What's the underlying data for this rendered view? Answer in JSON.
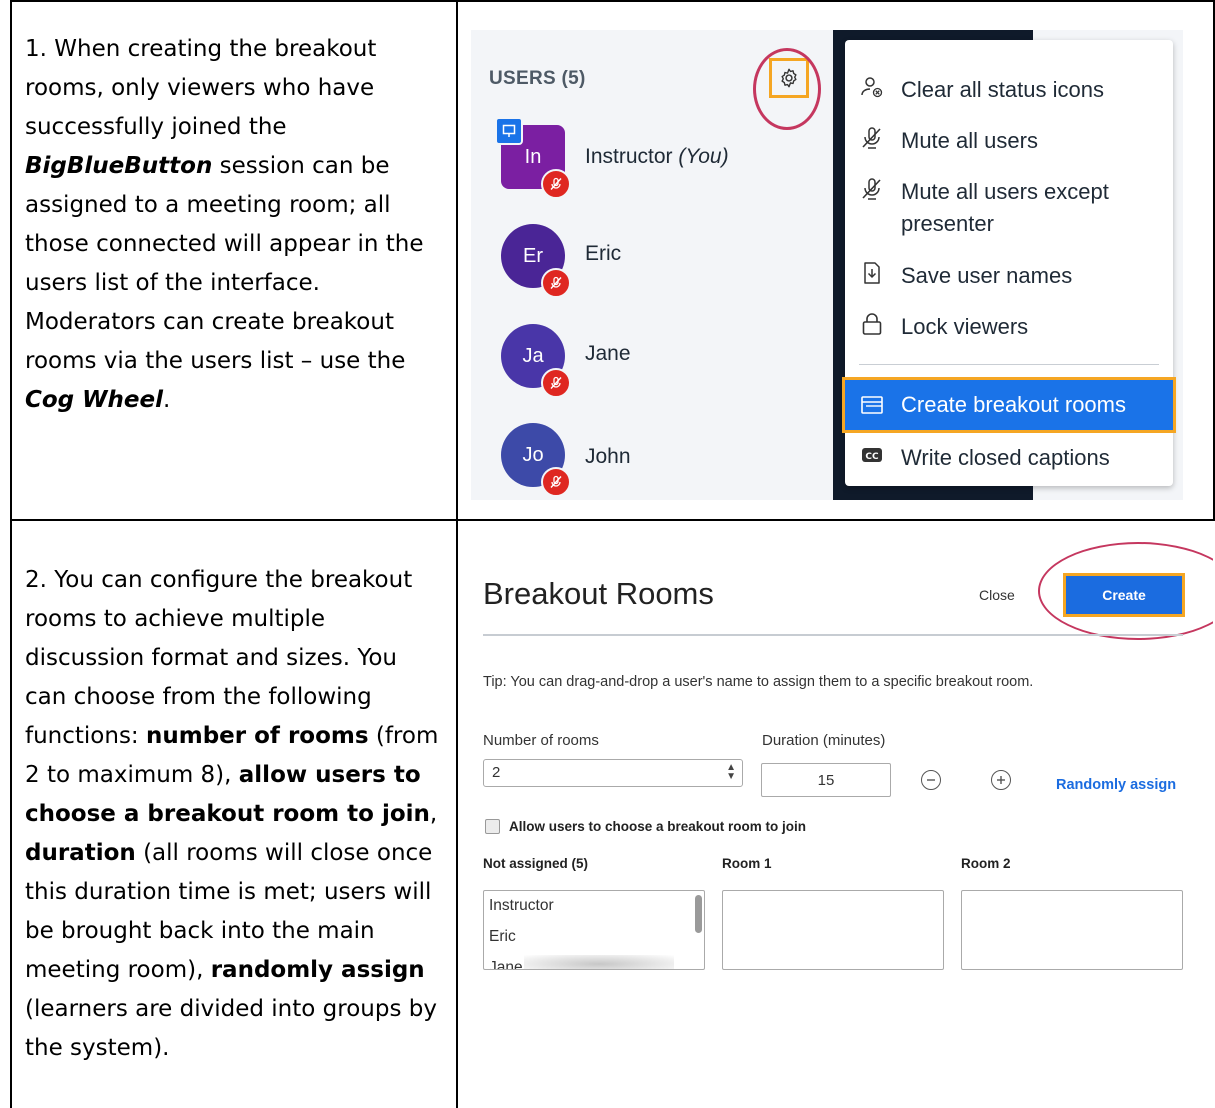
{
  "rows": [
    {
      "text_parts": [
        {
          "t": "1. When creating the breakout rooms, only viewers who have successfully joined the ",
          "s": "n"
        },
        {
          "t": "BigBlueButton",
          "s": "bi"
        },
        {
          "t": " session can be assigned to a meeting room; all those connected will appear in the users list of the interface. Moderators can create breakout rooms via the users list – use the ",
          "s": "n"
        },
        {
          "t": "Cog Wheel",
          "s": "bi"
        },
        {
          "t": ".",
          "s": "n"
        }
      ]
    },
    {
      "text_parts": [
        {
          "t": "2. You can configure the breakout rooms to achieve multiple discussion format and sizes. You can choose from the following functions: ",
          "s": "n"
        },
        {
          "t": "number of rooms",
          "s": "b"
        },
        {
          "t": " (from 2 to maximum 8), ",
          "s": "n"
        },
        {
          "t": "allow users to choose a breakout room to join",
          "s": "b"
        },
        {
          "t": ", ",
          "s": "n"
        },
        {
          "t": "duration",
          "s": "b"
        },
        {
          "t": " (all rooms will close once this duration time is met; users will be brought back into the main meeting room), ",
          "s": "n"
        },
        {
          "t": "randomly assign",
          "s": "b"
        },
        {
          "t": " (learners are divided into groups by the system).",
          "s": "n"
        }
      ]
    }
  ],
  "users_panel": {
    "title": "USERS (5)",
    "users": [
      {
        "initials": "In",
        "name": "Instructor",
        "suffix": "(You)",
        "color": "#7b1fa2"
      },
      {
        "initials": "Er",
        "name": "Eric",
        "color": "#4a2596"
      },
      {
        "initials": "Ja",
        "name": "Jane",
        "color": "#4936a8"
      },
      {
        "initials": "Jo",
        "name": "John",
        "color": "#3d4aa8"
      }
    ],
    "menu": [
      {
        "label": "Clear all status icons",
        "icon": "clear-status-icon"
      },
      {
        "label": "Mute all users",
        "icon": "mute-icon"
      },
      {
        "label": "Mute all users except presenter",
        "icon": "mute-icon"
      },
      {
        "label": "Save user names",
        "icon": "save-file-icon"
      },
      {
        "label": "Lock viewers",
        "icon": "lock-icon"
      },
      {
        "label": "Create breakout rooms",
        "icon": "breakout-icon"
      },
      {
        "label": "Write closed captions",
        "icon": "cc-icon"
      }
    ]
  },
  "breakout": {
    "title": "Breakout Rooms",
    "close_label": "Close",
    "create_label": "Create",
    "tip": "Tip: You can drag-and-drop a user's name to assign them to a specific breakout room.",
    "number_label": "Number of rooms",
    "number_value": "2",
    "duration_label": "Duration (minutes)",
    "duration_value": "15",
    "random_label": "Randomly assign",
    "allow_label": "Allow users to choose a breakout room to join",
    "not_assigned": "Not assigned (5)",
    "room1": "Room 1",
    "room2": "Room 2",
    "list": [
      "Instructor",
      "Eric",
      "Jane"
    ]
  },
  "colors": {
    "accent": "#1b6ce0",
    "highlight": "#f5a623",
    "annotation": "#c5375f",
    "mute": "#df2721"
  }
}
